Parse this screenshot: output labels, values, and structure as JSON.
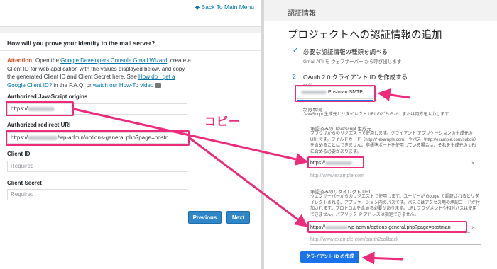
{
  "left": {
    "back_link": "Back To Main Menu",
    "question": "How will you prove your identity to the mail server?",
    "intro": {
      "attention": "Attention!",
      "t1": " Open the ",
      "link1": "Google Developers Console Gmail Wizard",
      "t2": ", create a Client ID for web application with the values displayed below, and copy the generated Client ID and Client Secret here. See ",
      "link2": "How do I get a Google Client ID?",
      "t3": " in the F.A.Q. or ",
      "link3": "watch our How-To video"
    },
    "origins_label": "Authorized JavaScript origins",
    "origins_value": "https://",
    "redirect_label": "Authorized redirect URI",
    "redirect_prefix": "https://",
    "redirect_value": "/wp-admin/options-general.php?page=postn",
    "client_id_label": "Client ID",
    "client_id_placeholder": "Required",
    "client_secret_label": "Client Secret",
    "client_secret_placeholder": "Required",
    "previous_button": "Previous",
    "next_button": "Next"
  },
  "right": {
    "header": "認証情報",
    "title": "プロジェクトへの認証情報の追加",
    "step1_title": "必要な認証情報の種類を調べる",
    "step1_sub": "Gmail API を ウェブサーバー から呼び出します",
    "step2_num": "2",
    "step2_title": "OAuth 2.0 クライアント ID を作成する",
    "name_label": "名前",
    "name_value": "Postman SMTP",
    "restrictions_label": "制限事項",
    "restrictions_text": "JavaScript 生成元とリダイレクト URI のどちらか、または両方を入力します",
    "js_origins_title": "承認済みの JavaScript 生成元",
    "js_origins_text": "ブラウザからのリクエストで使用します。クライアント アプリケーションの生成元の URI です。ワイルドカード（http://*.example.com）やパス（http://example.com/subdir）を含めることはできません。非標準ポートを使用している場合は、それを生成元の URI に含める必要があります。",
    "js_origin_value": "https://",
    "js_origin_placeholder": "http://www.example.com",
    "redirect_title": "承認済みのリダイレクト URI",
    "redirect_text": "ウェブサーバーからのリクエストで使用します。ユーザーが Google で認証されるとリダイレクトされる、アプリケーション内のパスです。パスにはアクセス用の承認コードが付加されます。プロトコルを含める必要があります。URL フラグメントや相対パスは使用できません。パブリック IP アドレスは指定できません。",
    "redirect_prefix": "https://",
    "redirect_value": "wp-admin/options-general.php?page=postman",
    "redirect_placeholder": "http://www.example.com/oauth2callback",
    "create_button": "クライアント ID の作成"
  },
  "annotation": {
    "copy_label": "コピー",
    "color": "#ee2a7b"
  },
  "colors": {
    "wp_link": "#0073aa",
    "wp_button": "#2f86c8",
    "google_blue": "#1a73e8",
    "attention": "#d54e21"
  }
}
